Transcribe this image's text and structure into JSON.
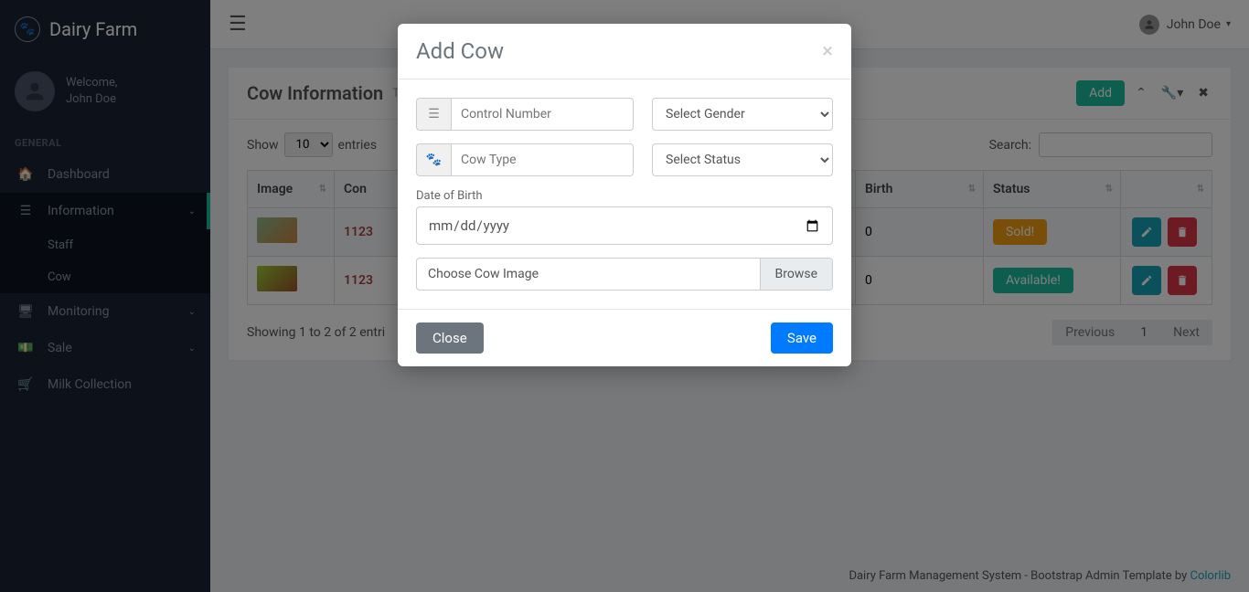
{
  "brand": "Dairy Farm",
  "user": {
    "welcome": "Welcome,",
    "name": "John Doe"
  },
  "sidebar": {
    "section": "GENERAL",
    "items": {
      "dashboard": "Dashboard",
      "information": "Information",
      "staff": "Staff",
      "cow": "Cow",
      "monitoring": "Monitoring",
      "sale": "Sale",
      "milk": "Milk Collection"
    }
  },
  "topbar": {
    "user": "John Doe"
  },
  "panel": {
    "title": "Cow Information",
    "add": "Add"
  },
  "table": {
    "show": "Show",
    "entries": "entries",
    "length_value": "10",
    "search_label": "Search:",
    "headers": {
      "image": "Image",
      "control": "Con",
      "birth": "Birth",
      "status": "Status"
    },
    "rows": [
      {
        "control": "1123",
        "birth": "0",
        "status": "Sold!"
      },
      {
        "control": "1123",
        "birth": "0",
        "status": "Available!"
      }
    ],
    "info": "Showing 1 to 2 of 2 entri",
    "prev": "Previous",
    "page1": "1",
    "next": "Next"
  },
  "footer": {
    "text": "Dairy Farm Management System - Bootstrap Admin Template by ",
    "link": "Colorlib"
  },
  "modal": {
    "title": "Add Cow",
    "control_placeholder": "Control Number",
    "gender_placeholder": "Select Gender",
    "cowtype_placeholder": "Cow Type",
    "status_placeholder": "Select Status",
    "dob_label": "Date of Birth",
    "dob_placeholder": "mm/dd/yyyy",
    "file_label": "Choose Cow Image",
    "browse": "Browse",
    "close": "Close",
    "save": "Save"
  }
}
